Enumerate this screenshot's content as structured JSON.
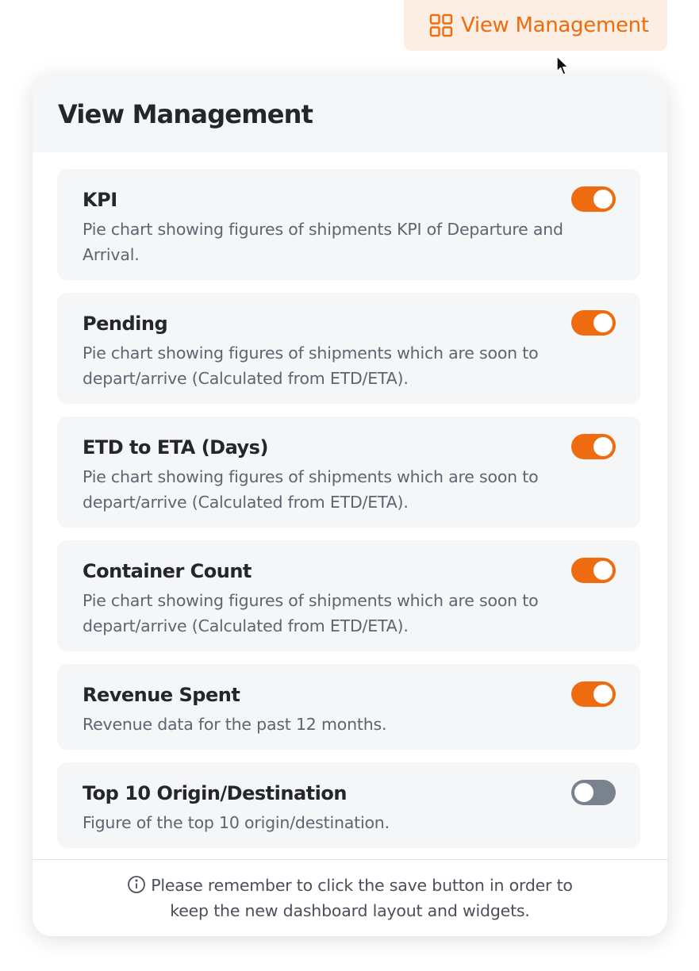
{
  "trigger": {
    "label": "View Management",
    "icon": "grid-icon",
    "accent_color": "#ee6b0f",
    "background_color": "#fdeee4"
  },
  "panel": {
    "title": "View Management",
    "items": [
      {
        "title": "KPI",
        "description": "Pie chart showing figures of shipments KPI of Departure and Arrival.",
        "enabled": true
      },
      {
        "title": "Pending",
        "description": "Pie chart showing figures of shipments which are soon to depart/arrive (Calculated from ETD/ETA).",
        "enabled": true
      },
      {
        "title": "ETD to ETA (Days)",
        "description": "Pie chart showing figures of shipments which are soon to depart/arrive (Calculated from ETD/ETA).",
        "enabled": true
      },
      {
        "title": "Container Count",
        "description": "Pie chart showing figures of shipments which are soon to depart/arrive (Calculated from ETD/ETA).",
        "enabled": true
      },
      {
        "title": "Revenue Spent",
        "description": "Revenue data for the past 12 months.",
        "enabled": true
      },
      {
        "title": "Top 10 Origin/Destination",
        "description": "Figure of the top 10 origin/destination.",
        "enabled": false
      }
    ],
    "footer": {
      "icon": "info-icon",
      "line1": "Please remember to click the save button in order to",
      "line2": "keep the new dashboard layout and widgets."
    },
    "toggle_on_color": "#ee6b0f",
    "toggle_off_color": "#7a8290"
  }
}
